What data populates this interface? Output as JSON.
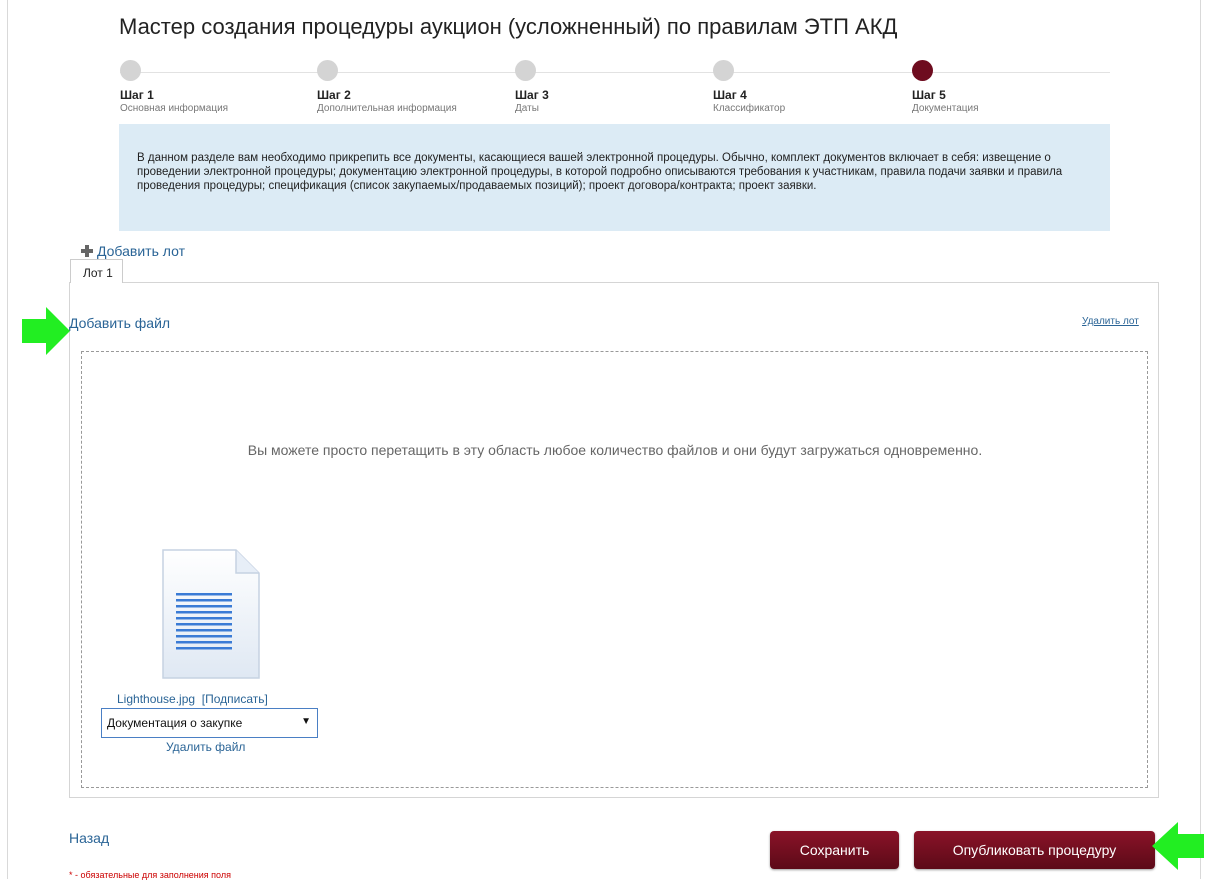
{
  "wizard": {
    "title": "Мастер создания процедуры аукцион (усложненный) по правилам ЭТП АКД",
    "steps": [
      {
        "name": "Шаг 1",
        "desc": "Основная информация",
        "active": false
      },
      {
        "name": "Шаг 2",
        "desc": "Дополнительная информация",
        "active": false
      },
      {
        "name": "Шаг 3",
        "desc": "Даты",
        "active": false
      },
      {
        "name": "Шаг 4",
        "desc": "Классификатор",
        "active": false
      },
      {
        "name": "Шаг 5",
        "desc": "Документация",
        "active": true
      }
    ],
    "info_text": "В данном разделе вам необходимо прикрепить все документы, касающиеся вашей электронной процедуры. Обычно, комплект документов включает в себя: извещение о проведении электронной процедуры; документацию электронной процедуры, в которой подробно описываются требования к участникам, правила подачи заявки и правила проведения процедуры; спецификация (список закупаемых/продаваемых позиций); проект договора/контракта; проект заявки."
  },
  "lots": {
    "add_lot_label": "Добавить лот",
    "tab_label": "Лот 1",
    "add_file_label": "Добавить файл",
    "delete_lot_label": "Удалить лот",
    "drop_hint": "Вы можете просто перетащить в эту область любое количество файлов и они будут загружаться одновременно.",
    "file": {
      "name": "Lighthouse.jpg",
      "sign_label": "[Подписать]",
      "doc_type": "Документация о закупке",
      "delete_label": "Удалить файл"
    }
  },
  "footer": {
    "back_label": "Назад",
    "required_note": "* - обязательные для заполнения поля",
    "save_label": "Сохранить",
    "publish_label": "Опубликовать процедуру"
  },
  "colors": {
    "accent": "#6e0c1f",
    "link": "#2a6496",
    "info_bg": "#dcebf5",
    "highlight_arrow": "#22ee22"
  },
  "icons": [
    "plus-icon",
    "document-icon",
    "dropdown-arrow-icon",
    "green-arrow-right-icon",
    "green-arrow-left-icon"
  ]
}
